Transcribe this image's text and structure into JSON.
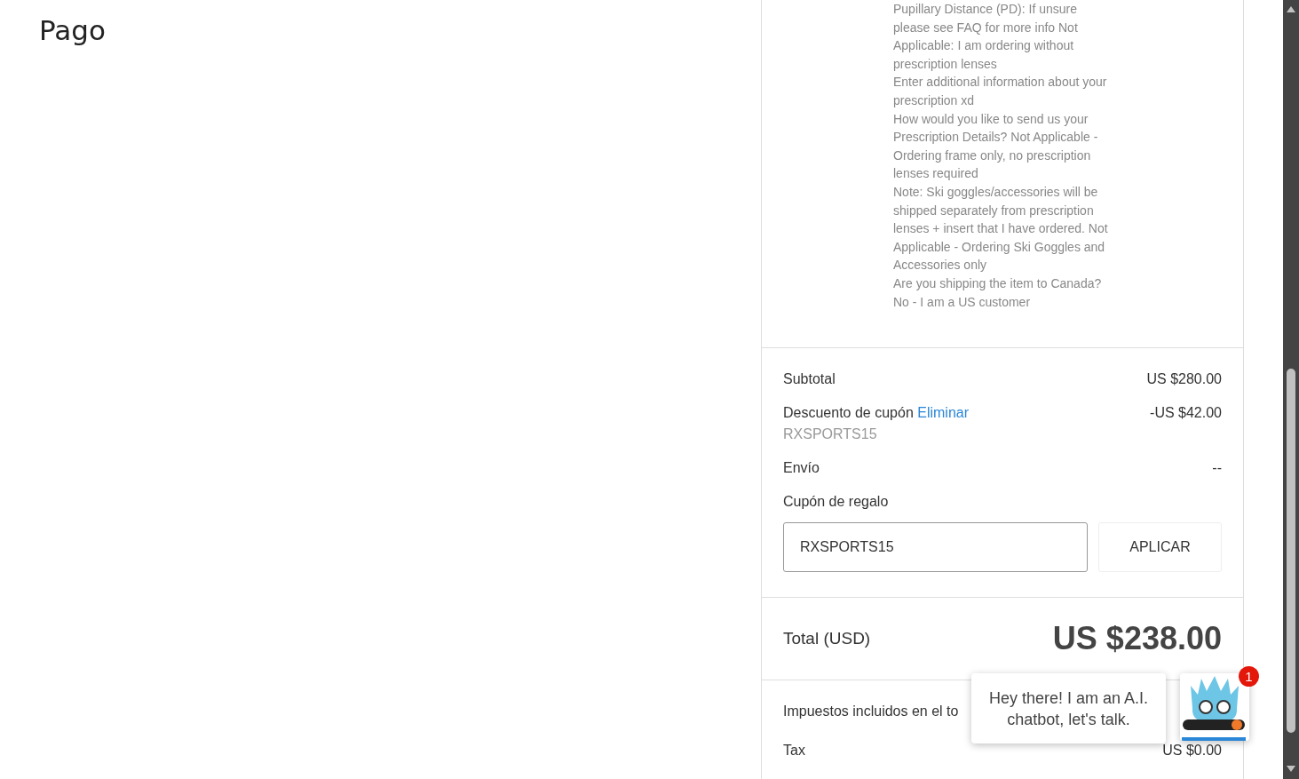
{
  "page_title": "Pago",
  "item_options": [
    "Pupillary Distance (PD): If unsure please see FAQ for more info Not Applicable: I am ordering without prescription lenses",
    "Enter additional information about your prescription xd",
    "How would you like to send us your Prescription Details? Not Applicable - Ordering frame only, no prescription lenses required",
    "Note: Ski goggles/accessories will be shipped separately from prescription lenses + insert that I have ordered. Not Applicable - Ordering Ski Goggles and Accessories only",
    "Are you shipping the item to Canada? No - I am a US customer"
  ],
  "summary": {
    "subtotal": {
      "label": "Subtotal",
      "value": "US $280.00"
    },
    "discount": {
      "label": "Descuento de cupón",
      "remove_link": "Eliminar",
      "code": "RXSPORTS15",
      "value": "-US $42.00"
    },
    "shipping": {
      "label": "Envío",
      "value": "--"
    },
    "gift_coupon": {
      "label": "Cupón de regalo",
      "value": "RXSPORTS15",
      "button": "APLICAR"
    }
  },
  "total": {
    "label": "Total (USD)",
    "value": "US $238.00"
  },
  "taxes": {
    "note": "Impuestos incluidos en el to",
    "tax_label": "Tax",
    "tax_value": "US $0.00"
  },
  "chat": {
    "message": "Hey there! I am an A.I. chatbot, let's talk.",
    "badge": "1"
  }
}
